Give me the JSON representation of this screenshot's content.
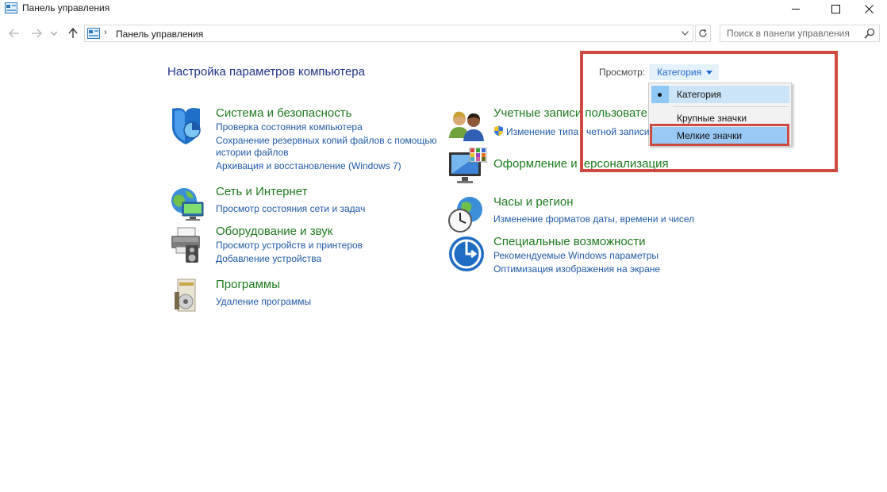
{
  "window": {
    "title": "Панель управления",
    "icon": "control-panel-icon"
  },
  "address": {
    "crumb": "Панель управления",
    "search_placeholder": "Поиск в панели управления"
  },
  "header": {
    "title": "Настройка параметров компьютера",
    "view_label": "Просмотр:",
    "view_value": "Категория"
  },
  "view_menu": {
    "items": [
      "Категория",
      "Крупные значки",
      "Мелкие значки"
    ],
    "selected": "Категория",
    "highlighted": "Мелкие значки"
  },
  "categories": {
    "system": {
      "icon": "shield-icon",
      "title": "Система и безопасность",
      "links": [
        "Проверка состояния компьютера",
        "Сохранение резервных копий файлов с помощью",
        "истории файлов",
        "Архивация и восстановление (Windows 7)"
      ]
    },
    "network": {
      "icon": "globe-network-icon",
      "title": "Сеть и Интернет",
      "links": [
        "Просмотр состояния сети и задач"
      ]
    },
    "hardware": {
      "icon": "printer-speaker-icon",
      "title": "Оборудование и звук",
      "links": [
        "Просмотр устройств и принтеров",
        "Добавление устройства"
      ]
    },
    "programs": {
      "icon": "programs-disc-icon",
      "title": "Программы",
      "links": [
        "Удаление программы"
      ]
    },
    "accounts": {
      "icon": "users-icon",
      "title": "Учетные записи пользовате",
      "links": [
        "Изменение типа",
        "четной записи"
      ],
      "link_icon": "uac-shield-icon"
    },
    "appearance": {
      "icon": "monitor-palette-icon",
      "title_parts": [
        "Оформление и ",
        "ерсонализация"
      ]
    },
    "clock": {
      "icon": "clock-globe-icon",
      "title": "Часы и регион",
      "links": [
        "Изменение форматов даты, времени и чисел"
      ]
    },
    "access": {
      "icon": "accessibility-icon",
      "title": "Специальные возможности",
      "links": [
        "Рекомендуемые Windows параметры",
        "Оптимизация изображения на экране"
      ]
    }
  },
  "colors": {
    "category_title": "#1c7a1c",
    "link": "#1f5aa8",
    "heading": "#1e3287",
    "annotation": "#cf4a40",
    "menu_highlight": "#99c9f4"
  }
}
